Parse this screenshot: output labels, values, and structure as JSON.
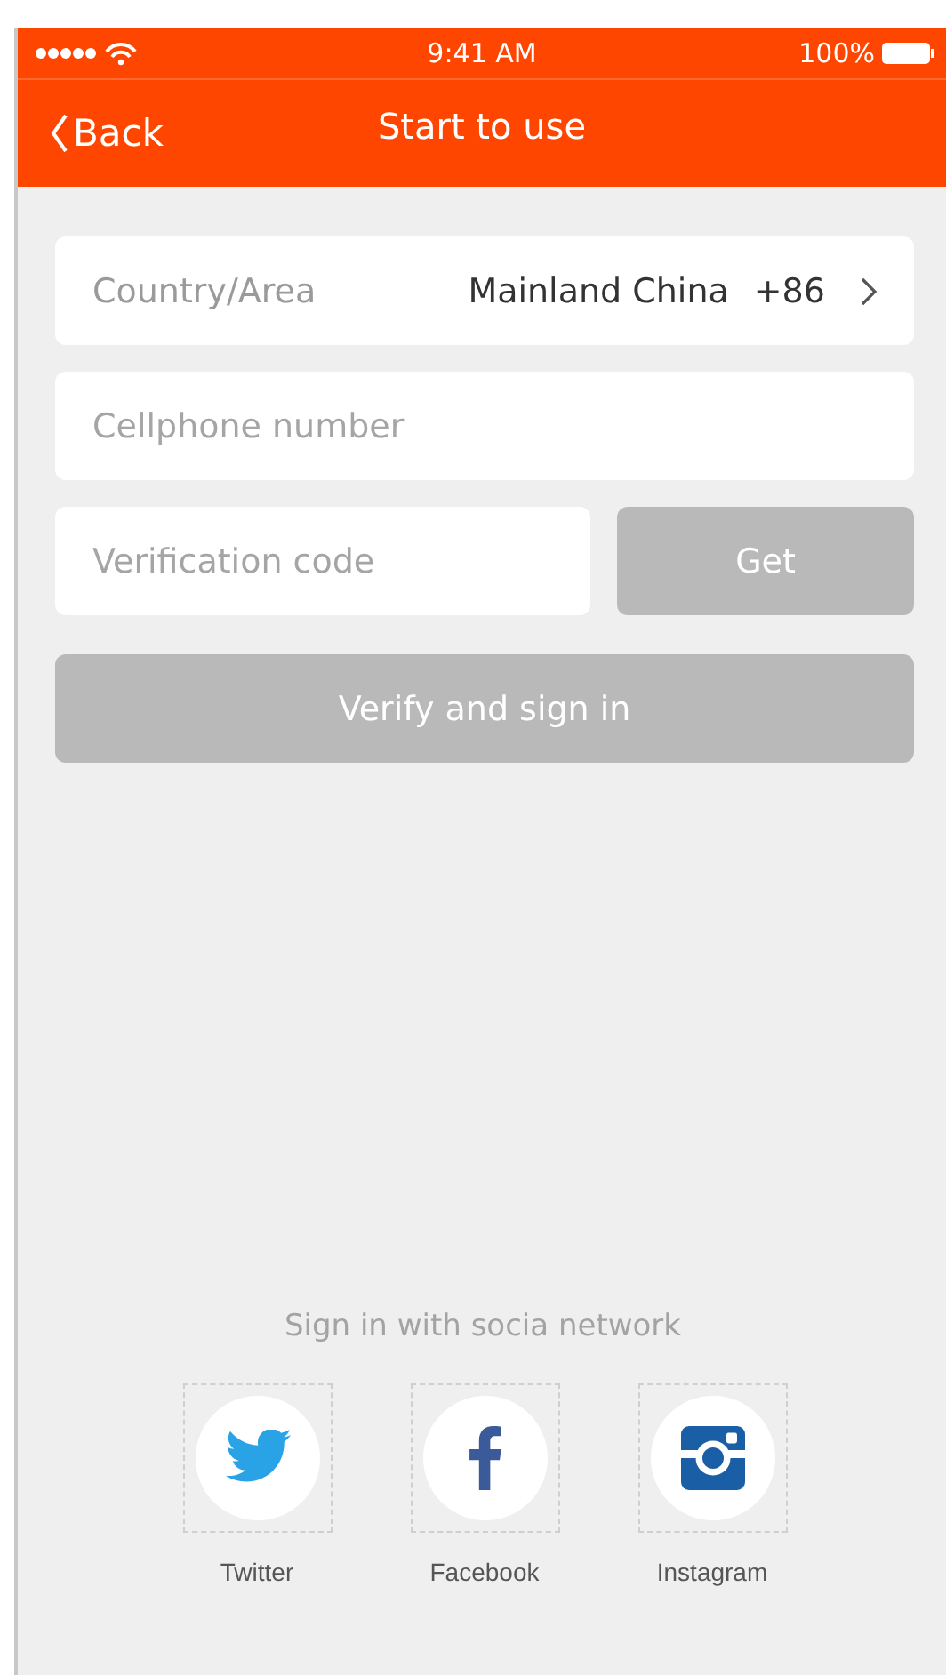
{
  "status_bar": {
    "time": "9:41 AM",
    "battery": "100%"
  },
  "nav": {
    "back": "Back",
    "title": "Start to use"
  },
  "country": {
    "label": "Country/Area",
    "value": "Mainland China",
    "code": "+86"
  },
  "phone_field": {
    "placeholder": "Cellphone number"
  },
  "code_field": {
    "placeholder": "Verification code"
  },
  "get_button": {
    "label": "Get",
    "disabled": true
  },
  "sign_in_button": {
    "label": "Verify and sign in",
    "disabled": true
  },
  "social": {
    "heading": "Sign in with socia network",
    "items": [
      {
        "kind": "twitter",
        "label": "Twitter"
      },
      {
        "kind": "facebook",
        "label": "Facebook"
      },
      {
        "kind": "instagram",
        "label": "Instagram"
      }
    ]
  }
}
